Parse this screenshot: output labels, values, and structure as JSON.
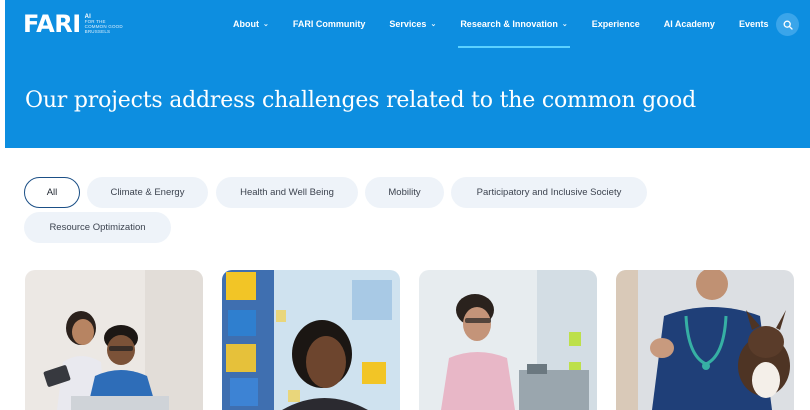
{
  "brand": {
    "logo_text": "FARI",
    "tagline_ai": "AI",
    "tagline_1": "For the",
    "tagline_2": "common good",
    "tagline_3": "Brussels"
  },
  "nav": {
    "items": [
      {
        "label": "About",
        "has_dropdown": true,
        "active": false
      },
      {
        "label": "FARI Community",
        "has_dropdown": false,
        "active": false
      },
      {
        "label": "Services",
        "has_dropdown": true,
        "active": false
      },
      {
        "label": "Research & Innovation",
        "has_dropdown": true,
        "active": true
      },
      {
        "label": "Experience",
        "has_dropdown": false,
        "active": false
      },
      {
        "label": "AI Academy",
        "has_dropdown": false,
        "active": false
      },
      {
        "label": "Events",
        "has_dropdown": false,
        "active": false
      }
    ],
    "search_icon": "search-icon"
  },
  "hero": {
    "title": "Our projects address challenges related to the common good"
  },
  "filters": {
    "items": [
      {
        "label": "All",
        "active": true
      },
      {
        "label": "Climate & Energy",
        "active": false
      },
      {
        "label": "Health and Well Being",
        "active": false
      },
      {
        "label": "Mobility",
        "active": false
      },
      {
        "label": "Participatory and Inclusive Society",
        "active": false
      },
      {
        "label": "Resource Optimization",
        "active": false
      }
    ]
  },
  "colors": {
    "brand_blue": "#0d8ee0",
    "active_underline": "#5bd1ff",
    "chip_bg": "#eef3f9",
    "chip_active_border": "#1b4f86"
  }
}
